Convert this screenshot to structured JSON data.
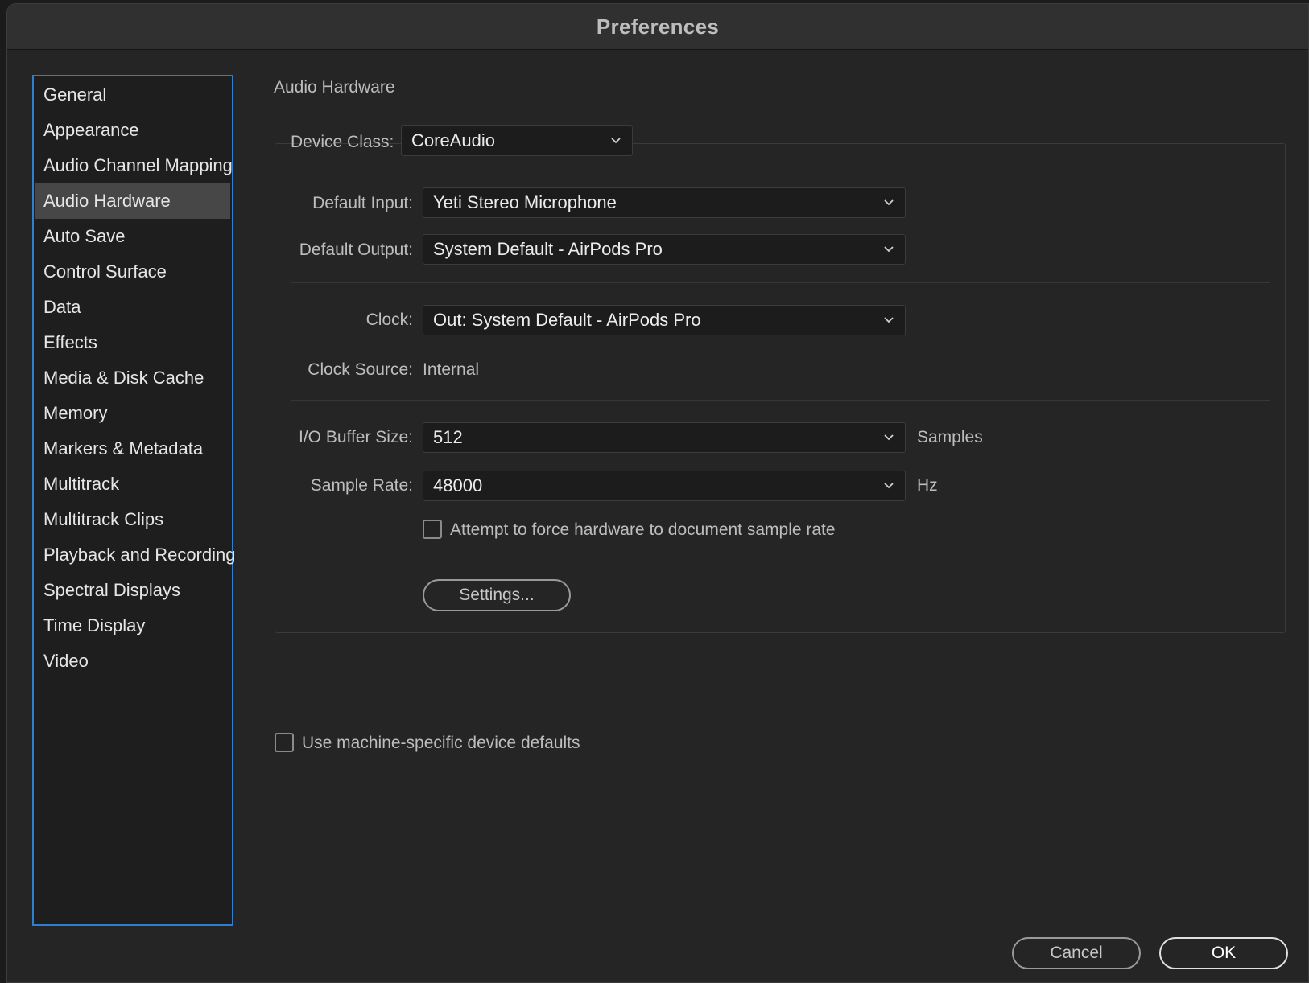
{
  "window": {
    "title": "Preferences"
  },
  "sidebar": {
    "items": [
      {
        "label": "General"
      },
      {
        "label": "Appearance"
      },
      {
        "label": "Audio Channel Mapping"
      },
      {
        "label": "Audio Hardware",
        "selected": true
      },
      {
        "label": "Auto Save"
      },
      {
        "label": "Control Surface"
      },
      {
        "label": "Data"
      },
      {
        "label": "Effects"
      },
      {
        "label": "Media & Disk Cache"
      },
      {
        "label": "Memory"
      },
      {
        "label": "Markers & Metadata"
      },
      {
        "label": "Multitrack"
      },
      {
        "label": "Multitrack Clips"
      },
      {
        "label": "Playback and Recording"
      },
      {
        "label": "Spectral Displays"
      },
      {
        "label": "Time Display"
      },
      {
        "label": "Video"
      }
    ]
  },
  "panel": {
    "title": "Audio Hardware",
    "device_class": {
      "label": "Device Class:",
      "value": "CoreAudio"
    },
    "default_input": {
      "label": "Default Input:",
      "value": "Yeti Stereo Microphone"
    },
    "default_output": {
      "label": "Default Output:",
      "value": "System Default - AirPods Pro"
    },
    "clock": {
      "label": "Clock:",
      "value": "Out: System Default - AirPods Pro"
    },
    "clock_source": {
      "label": "Clock Source:",
      "value": "Internal"
    },
    "buffer_size": {
      "label": "I/O Buffer Size:",
      "value": "512",
      "unit": "Samples"
    },
    "sample_rate": {
      "label": "Sample Rate:",
      "value": "48000",
      "unit": "Hz"
    },
    "force_sample_rate": {
      "label": "Attempt to force hardware to document sample rate",
      "checked": false
    },
    "settings_button": "Settings...",
    "machine_defaults": {
      "label": "Use machine-specific device defaults",
      "checked": false
    }
  },
  "footer": {
    "cancel": "Cancel",
    "ok": "OK"
  },
  "icons": {
    "dropdown": "chevron-down-icon"
  },
  "colors": {
    "selection_border": "#2f7fd1",
    "selected_item_bg": "#474747",
    "background": "#252525"
  }
}
